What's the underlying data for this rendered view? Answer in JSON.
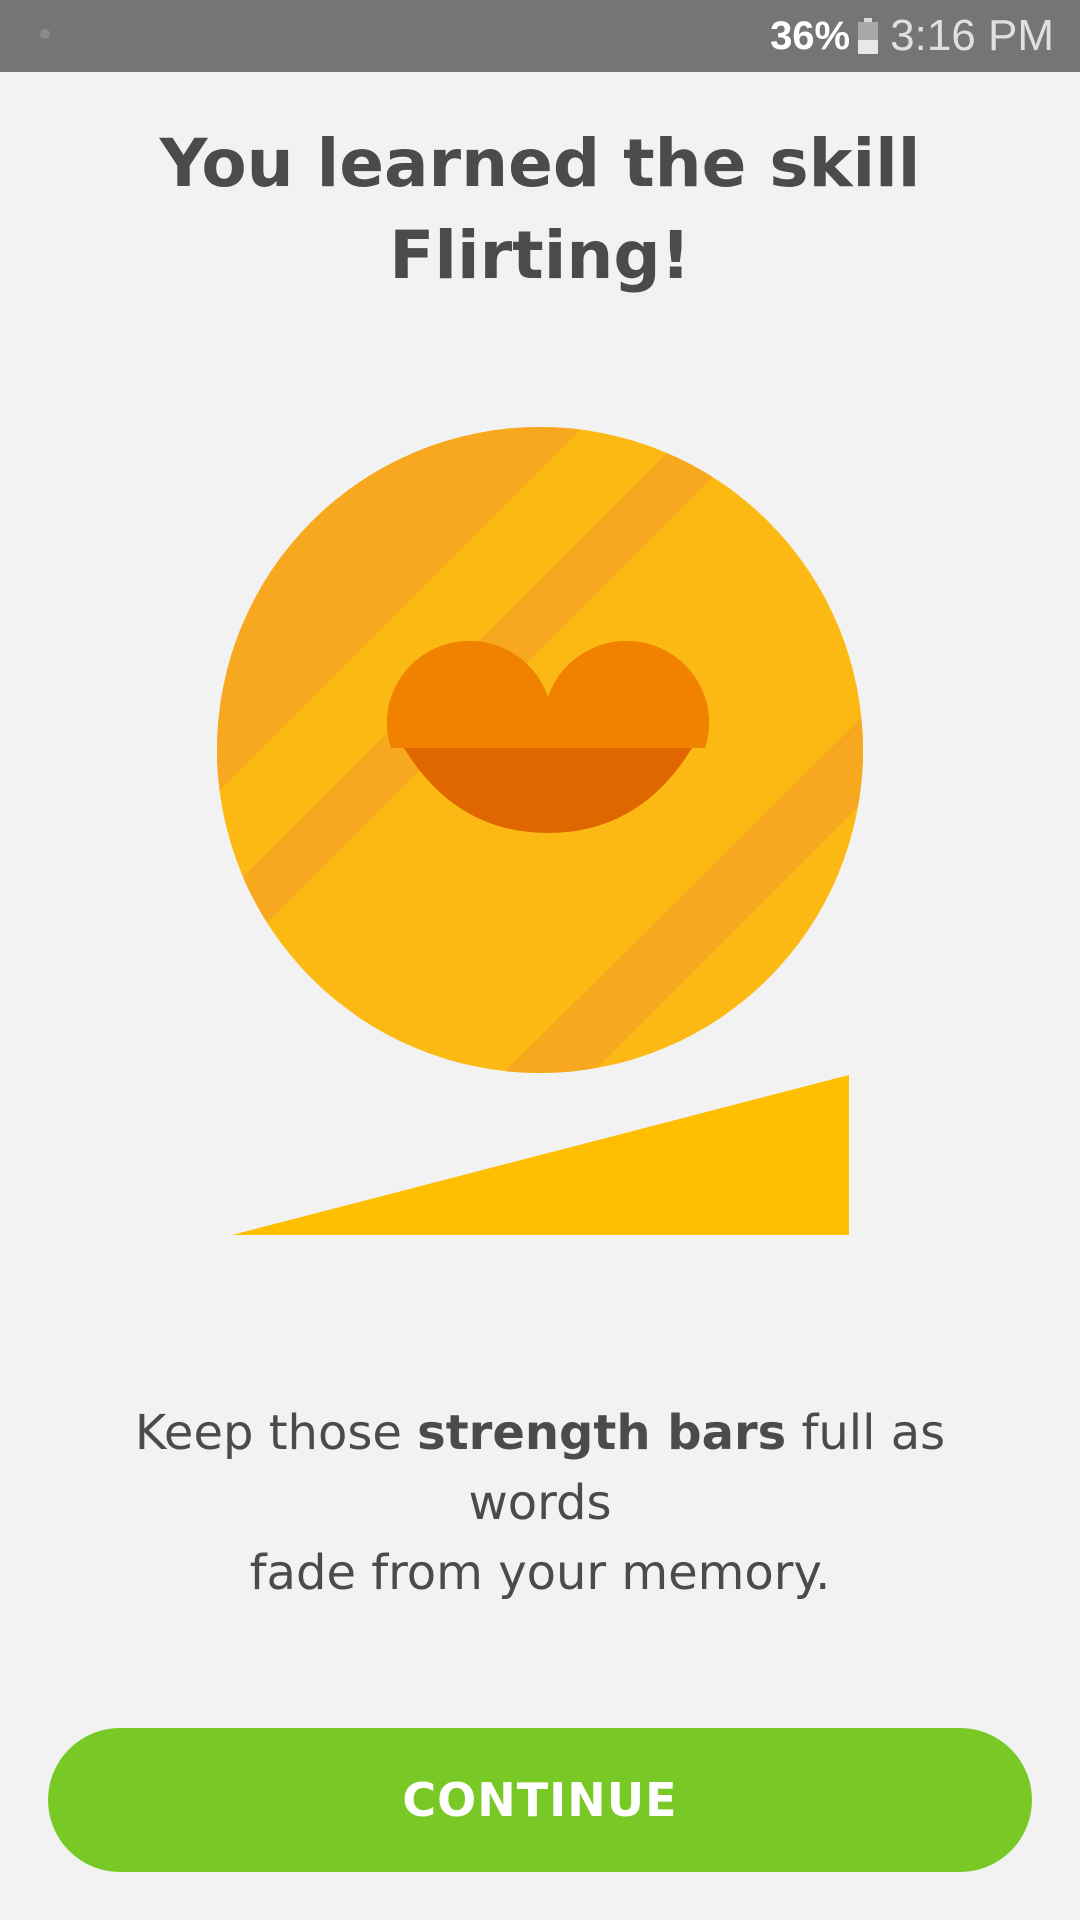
{
  "status_bar": {
    "battery_percent": "36%",
    "time": "3:16 PM"
  },
  "heading": {
    "line1": "You learned the skill",
    "line2": "Flirting!"
  },
  "illustration": {
    "icon": "lips-icon",
    "colors": {
      "circle_light": "#fdb913",
      "circle_stripe": "#f8a81e",
      "lip_upper": "#f08200",
      "lip_lower": "#e06600",
      "strength_bar": "#ffbe00"
    },
    "strength_level": 1.0
  },
  "message": {
    "before": "Keep those ",
    "bold": "strength bars",
    "after_line1": " full as words",
    "line2": "fade from your memory."
  },
  "buttons": {
    "continue_label": "CONTINUE"
  },
  "colors": {
    "background": "#f2f2f2",
    "status_bar": "#757575",
    "text": "#4b4b4b",
    "button": "#78c925"
  }
}
